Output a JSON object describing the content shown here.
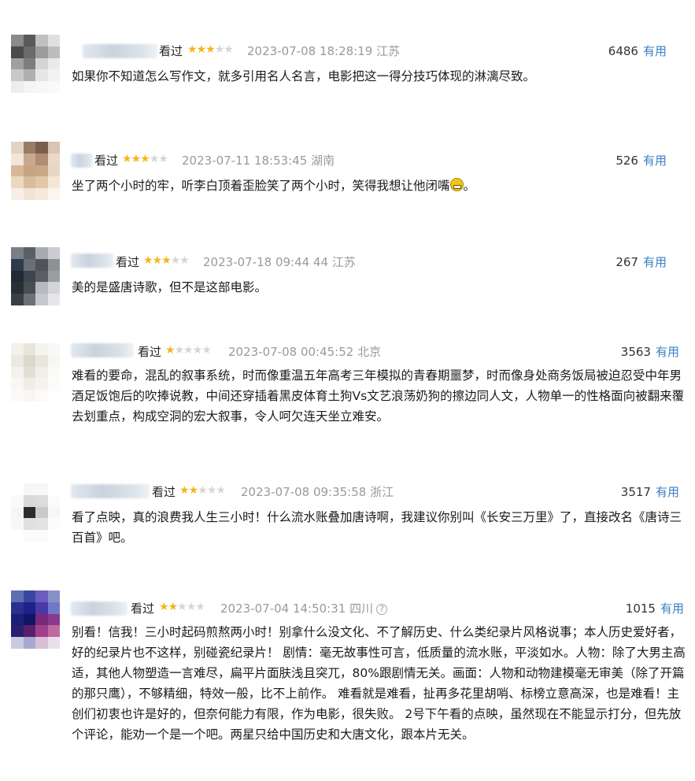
{
  "comments": [
    {
      "seen": "看过",
      "rating": 3,
      "datetime": "2023-07-08 18:28:19",
      "location": "江苏",
      "votes": "6486",
      "useful": "有用",
      "text": "如果你不知道怎么写作文，就多引用名人名言，电影把这一得分技巧体现的淋漓尽致。",
      "avatar_colors": [
        "#8a8a8a",
        "#5a5a5a",
        "#c0c0c0",
        "#e0e0e0",
        "#4a4a4a",
        "#6a6a6a",
        "#9c9c9c",
        "#bdbdbd",
        "#a0a0a0",
        "#7d7d7d",
        "#d4d4d4",
        "#eaeaea",
        "#c8c8c8",
        "#b0b0b0",
        "#e6e6e6",
        "#f2f2f2",
        "#ededed",
        "#f5f5f5",
        "#f7f7f7",
        "#fafafa"
      ]
    },
    {
      "seen": "看过",
      "rating": 3,
      "datetime": "2023-07-11 18:53:45",
      "location": "湖南",
      "votes": "526",
      "useful": "有用",
      "text": "坐了两个小时的牢，听李白顶着歪脸笑了两个小时，笑得我想让他闭嘴",
      "emoji_after": true,
      "avatar_colors": [
        "#e3d3c2",
        "#9a7b66",
        "#7a5e4d",
        "#d9c5b2",
        "#f1e6d8",
        "#c8a98e",
        "#b08c70",
        "#e9d9c6",
        "#d8b898",
        "#c7a481",
        "#caa786",
        "#e8d6c2",
        "#ecd8bf",
        "#d8bc9e",
        "#e1c8aa",
        "#f3e7d8",
        "#f7efe6",
        "#f2e4d3",
        "#f4e9dc",
        "#faf5ee"
      ]
    },
    {
      "seen": "看过",
      "rating": 3,
      "datetime": "2023-07-18 09:44 44",
      "location": "江苏",
      "votes": "267",
      "useful": "有用",
      "text": "美的是盛唐诗歌，但不是这部电影。",
      "avatar_colors": [
        "#7a7e86",
        "#5b5f66",
        "#a8acb1",
        "#c9ccd0",
        "#2e3b4a",
        "#6b6f75",
        "#4f535a",
        "#8e9297",
        "#1f2a36",
        "#3c444e",
        "#5a5e64",
        "#9a9ea3",
        "#2a2f36",
        "#474d55",
        "#b6b9bd",
        "#d3d5d8",
        "#3a3f46",
        "#6c7177",
        "#c5c7ca",
        "#e6e7e8"
      ]
    },
    {
      "seen": "看过",
      "rating": 1,
      "datetime": "2023-07-08 00:45:52",
      "location": "北京",
      "votes": "3563",
      "useful": "有用",
      "text": "难看的要命，混乱的叙事系统，时而像重温五年高考三年模拟的青春期噩梦，时而像身处商务饭局被迫忍受中年男酒足饭饱后的吹捧说教，中间还穿插着黑皮体育土狗Vs文艺浪荡奶狗的擦边同人文，人物单一的性格面向被翻来覆去划重点，构成空洞的宏大叙事，令人呵欠连天坐立难安。",
      "avatar_colors": [
        "#f3f1ea",
        "#e8e5da",
        "#f6f4ee",
        "#faf9f5",
        "#eceae0",
        "#dcd9cc",
        "#e9e6dc",
        "#f7f6f1",
        "#f4f2ec",
        "#e2dfd3",
        "#f0eee7",
        "#fbfaf7",
        "#f8f7f2",
        "#efede5",
        "#f5f3ed",
        "#fcfbf9",
        "#fbfaf7",
        "#f7f6f2",
        "#fcfbf8",
        "#fefefd"
      ]
    },
    {
      "seen": "看过",
      "rating": 2,
      "datetime": "2023-07-08 09:35:58",
      "location": "浙江",
      "votes": "3517",
      "useful": "有用",
      "text": "看了点映，真的浪费我人生三小时！什么流水账叠加唐诗啊，我建议你别叫《长安三万里》了，直接改名《唐诗三百首》吧。",
      "avatar_colors": [
        "#ffffff",
        "#f7f7f7",
        "#f7f7f7",
        "#ffffff",
        "#fafafa",
        "#d9d9d9",
        "#dcdcdc",
        "#fbfbfb",
        "#f5f5f5",
        "#2c2c2c",
        "#c9c9c9",
        "#f7f7f7",
        "#f8f8f8",
        "#e0e0e0",
        "#e3e3e3",
        "#fcfcfc",
        "#ffffff",
        "#fbfbfb",
        "#fbfbfb",
        "#ffffff"
      ]
    },
    {
      "seen": "看过",
      "rating": 2,
      "datetime": "2023-07-04 14:50:31",
      "location": "四川",
      "votes": "1015",
      "useful": "有用",
      "text": "别看！信我！三小时起码煎熬两小时！别拿什么没文化、不了解历史、什么类纪录片风格说事；本人历史爱好者，好的纪录片也不这样，别碰瓷纪录片！ 剧情：毫无故事性可言，低质量的流水账，平淡如水。人物：除了大男主高适，其他人物塑造一言难尽，扁平片面肤浅且突兀，80%跟剧情无关。画面：人物和动物建模毫无审美（除了开篇的那只鹰），不够精细，特效一般，比不上前作。 难看就是难看，扯再多花里胡哨、标榜立意高深，也是难看！主创们初衷也许是好的，但奈何能力有限，作为电影，很失败。 2号下午看的点映，虽然现在不能显示打分，但先放个评论，能劝一个是一个吧。两星只给中国历史和大唐文化，跟本片无关。",
      "has_question_icon": true,
      "avatar_colors": [
        "#5c6fb0",
        "#3a46a0",
        "#6a5cc0",
        "#8890c8",
        "#2b2f8f",
        "#1c2288",
        "#4a3aa8",
        "#6e7ac6",
        "#1b1f7a",
        "#101566",
        "#7a2a7a",
        "#8a3a8a",
        "#2a2070",
        "#5a1f6a",
        "#a0408a",
        "#c06aa0",
        "#c8cce0",
        "#a8a8d0",
        "#d8c0d8",
        "#e8e0ea"
      ]
    }
  ]
}
